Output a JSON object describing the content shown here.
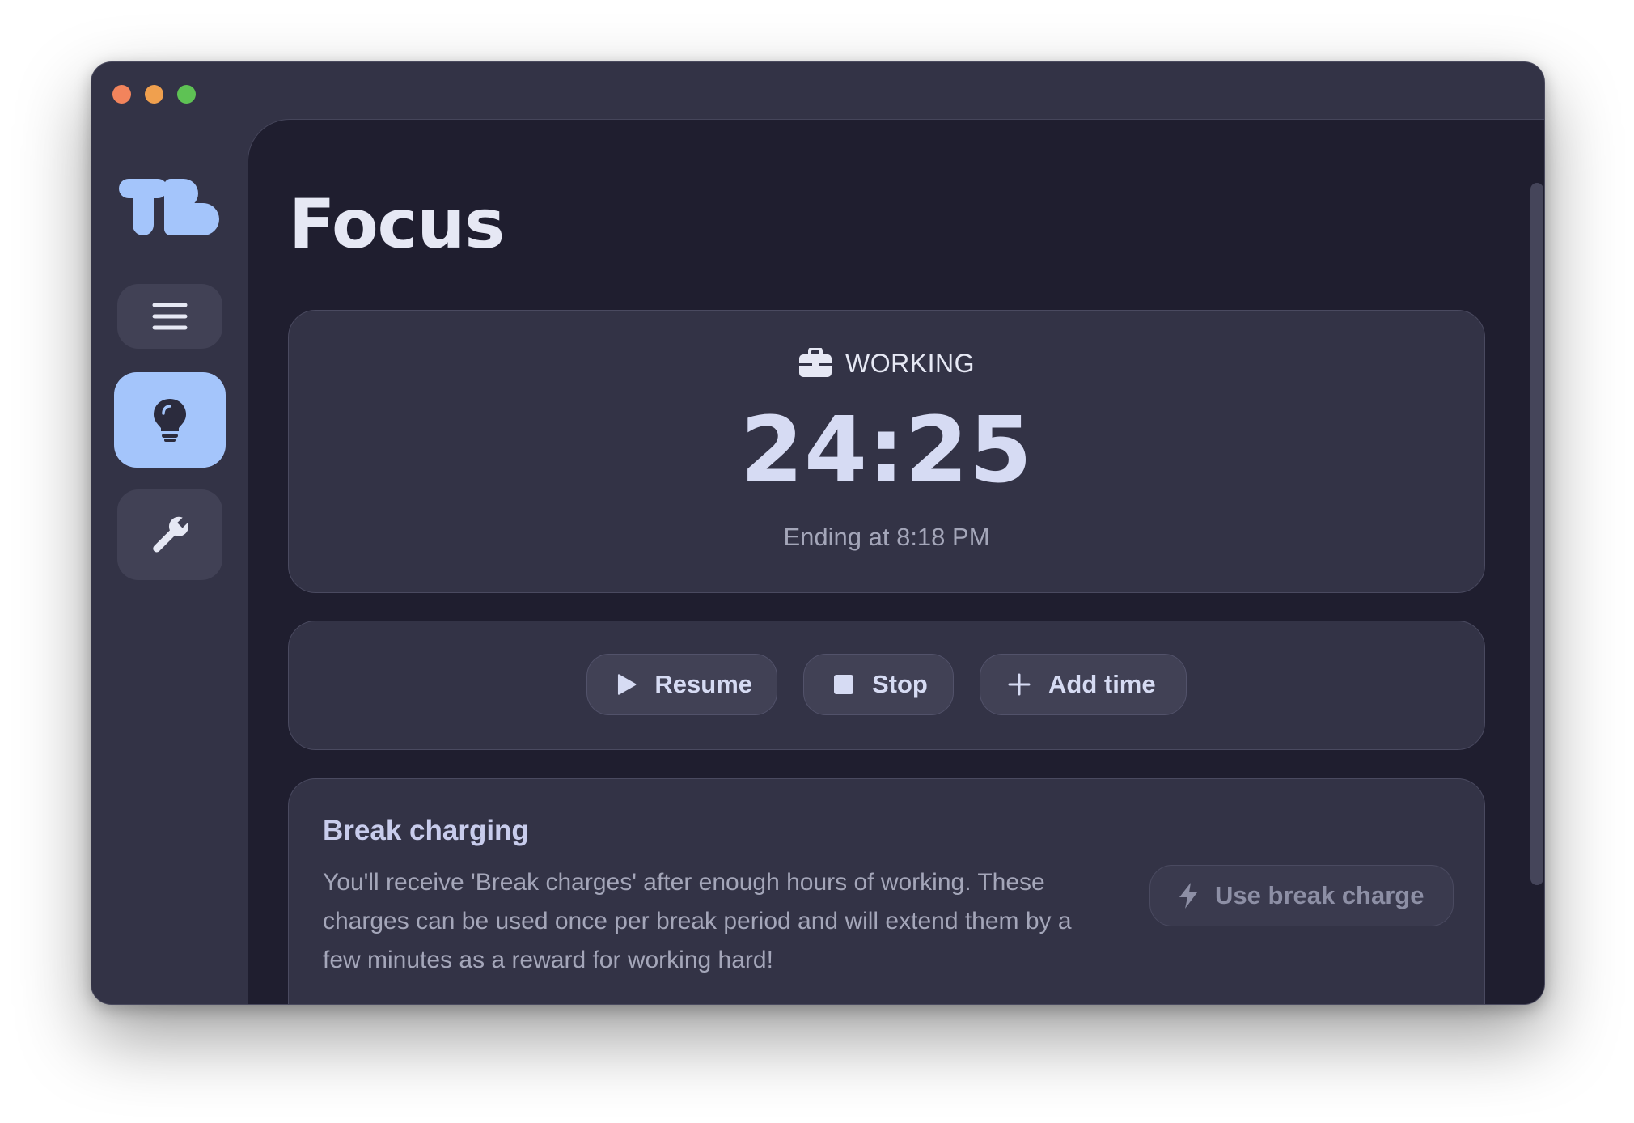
{
  "window": {
    "traffic_lights": {
      "close_color": "#f2845c",
      "minimize_color": "#f0a04e",
      "maximize_color": "#5ec254"
    }
  },
  "sidebar": {
    "logo": "TB",
    "items": [
      {
        "icon": "hamburger-menu-icon",
        "active": false
      },
      {
        "icon": "lightbulb-icon",
        "active": true
      },
      {
        "icon": "wrench-icon",
        "active": false
      }
    ],
    "accent_color": "#a4c5fb"
  },
  "main": {
    "title": "Focus",
    "timer": {
      "status_icon": "briefcase-icon",
      "status": "WORKING",
      "time": "24:25",
      "ending": "Ending at 8:18 PM"
    },
    "controls": {
      "resume_label": "Resume",
      "stop_label": "Stop",
      "add_time_label": "Add time"
    },
    "break_charging": {
      "title": "Break charging",
      "description": "You'll receive 'Break charges' after enough hours of working. These charges can be used once per break period and will extend them by a few minutes as a reward for working hard!",
      "button_label": "Use break charge",
      "button_enabled": false
    }
  },
  "colors": {
    "sidebar_bg": "#333346",
    "main_bg": "#1f1e2f",
    "card_bg": "#333346",
    "text_primary": "#e6e8f4",
    "text_muted": "#a4a6b9"
  }
}
